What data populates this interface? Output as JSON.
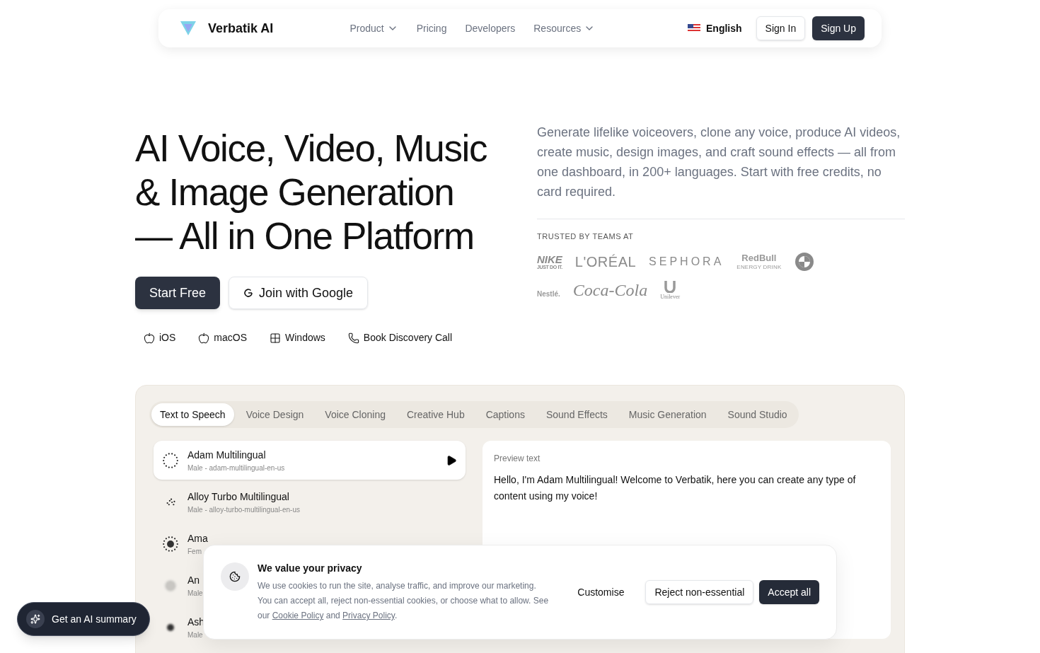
{
  "nav": {
    "brand": "Verbatik AI",
    "links": [
      {
        "label": "Product",
        "dropdown": true
      },
      {
        "label": "Pricing",
        "dropdown": false
      },
      {
        "label": "Developers",
        "dropdown": false
      },
      {
        "label": "Resources",
        "dropdown": true
      }
    ],
    "language": "English",
    "sign_in": "Sign In",
    "sign_up": "Sign Up"
  },
  "hero": {
    "heading": [
      "AI Voice, Video, Music",
      "& Image Generation",
      "— All in One Platform"
    ],
    "start": "Start Free",
    "google": "Join with Google",
    "platforms": [
      {
        "kind": "apple",
        "label": "iOS"
      },
      {
        "kind": "apple",
        "label": "macOS"
      },
      {
        "kind": "windows",
        "label": "Windows"
      },
      {
        "kind": "phone",
        "label": "Book Discovery Call"
      }
    ],
    "description": "Generate lifelike voiceovers, clone any voice, produce AI videos, create music, design images, and craft sound effects — all from one dashboard, in 200+ languages. Start with free credits, no card required.",
    "trusted_label": "TRUSTED BY TEAMS AT",
    "logos": [
      {
        "kind": "nike",
        "text": "NIKE",
        "sub": "JUST DO IT."
      },
      {
        "kind": "serif",
        "text": "L'ORÉAL"
      },
      {
        "kind": "spaced",
        "text": "SEPHORA"
      },
      {
        "kind": "redbull",
        "text": "RedBull",
        "sub": "ENERGY DRINK"
      },
      {
        "kind": "emblem"
      },
      {
        "kind": "nestle",
        "text": "Nestlé."
      },
      {
        "kind": "script",
        "text": "Coca-Cola"
      },
      {
        "kind": "unilever",
        "text": "Unilever"
      }
    ]
  },
  "demo": {
    "tabs": [
      {
        "label": "Text to Speech",
        "selected": true
      },
      {
        "label": "Voice Design",
        "selected": false
      },
      {
        "label": "Voice Cloning",
        "selected": false
      },
      {
        "label": "Creative Hub",
        "selected": false
      },
      {
        "label": "Captions",
        "selected": false
      },
      {
        "label": "Sound Effects",
        "selected": false
      },
      {
        "label": "Music Generation",
        "selected": false
      },
      {
        "label": "Sound Studio",
        "selected": false
      }
    ],
    "voices": [
      {
        "name": "Adam Multilingual",
        "detail": "Male - adam-multilingual-en-us",
        "selected": true
      },
      {
        "name": "Alloy Turbo Multilingual",
        "detail": "Male - alloy-turbo-multilingual-en-us",
        "selected": false
      },
      {
        "name": "Ama",
        "detail": "Fem",
        "selected": false
      },
      {
        "name": "An",
        "detail": "Male",
        "selected": false
      },
      {
        "name": "Ash",
        "detail": "Male",
        "selected": false
      }
    ],
    "preview_label": "Preview text",
    "preview_text": "Hello, I'm Adam Multilingual! Welcome to Verbatik, here you can create any type of content using my voice!"
  },
  "cookie": {
    "title": "We value your privacy",
    "text": "We use cookies to run the site, analyse traffic, and improve our marketing. You can accept all, reject non-essential cookies, or choose what to allow. See our",
    "link1": "Cookie Policy",
    "and": "and",
    "link2": "Privacy Policy",
    "end": ".",
    "customise": "Customise",
    "reject": "Reject non-essential",
    "accept": "Accept all"
  },
  "summary_button": "Get an AI summary"
}
